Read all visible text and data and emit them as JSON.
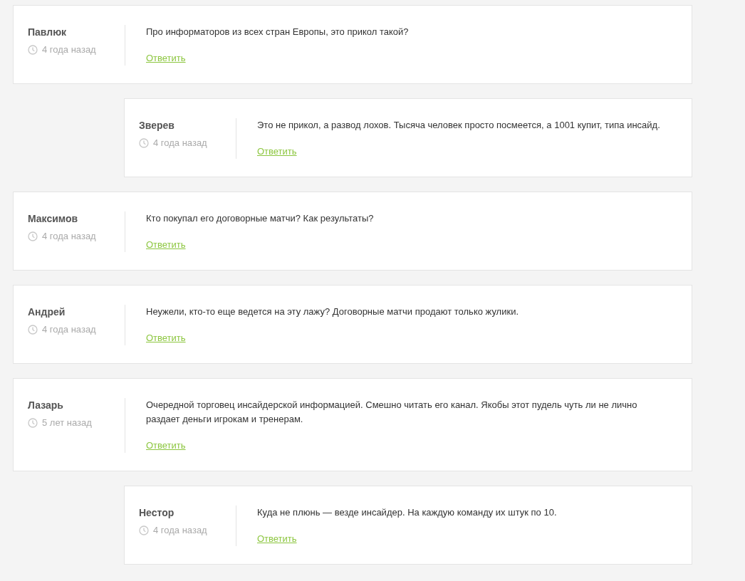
{
  "comments": [
    {
      "author": "Павлюк",
      "time": "4 года назад",
      "text": "Про информаторов из всех стран Европы, это прикол такой?",
      "reply": "Ответить",
      "children": [
        {
          "author": "Зверев",
          "time": "4 года назад",
          "text": "Это не прикол, а развод лохов. Тысяча человек просто посмеется, а 1001 купит, типа инсайд.",
          "reply": "Ответить"
        }
      ]
    },
    {
      "author": "Максимов",
      "time": "4 года назад",
      "text": "Кто покупал его договорные матчи? Как результаты?",
      "reply": "Ответить"
    },
    {
      "author": "Андрей",
      "time": "4 года назад",
      "text": "Неужели, кто-то еще ведется на эту лажу? Договорные матчи продают только жулики.",
      "reply": "Ответить"
    },
    {
      "author": "Лазарь",
      "time": "5 лет назад",
      "text": "Очередной торговец инсайдерской информацией. Смешно читать его канал. Якобы этот пудель чуть ли не лично раздает деньги игрокам и тренерам.",
      "reply": "Ответить",
      "children": [
        {
          "author": "Нестор",
          "time": "4 года назад",
          "text": "Куда не плюнь — везде инсайдер. На каждую команду их штук по 10.",
          "reply": "Ответить"
        }
      ]
    }
  ]
}
